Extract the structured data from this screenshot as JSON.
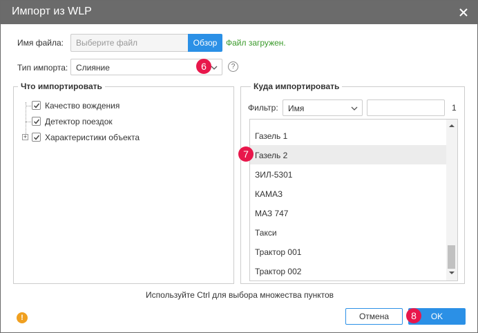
{
  "dialog": {
    "title": "Импорт из WLP"
  },
  "file": {
    "label": "Имя файла:",
    "placeholder": "Выберите файл",
    "browse_label": "Обзор",
    "status": "Файл загружен."
  },
  "import_type": {
    "label": "Тип импорта:",
    "value": "Слияние"
  },
  "what_to_import": {
    "title": "Что импортировать",
    "items": [
      {
        "label": "Качество вождения",
        "checked": true
      },
      {
        "label": "Детектор поездок",
        "checked": true
      },
      {
        "label": "Характеристики объекта",
        "checked": true,
        "expandable": true
      }
    ]
  },
  "where_to_import": {
    "title": "Куда импортировать",
    "filter_label": "Фильтр:",
    "filter_value": "Имя",
    "filter_text": "",
    "count": "1",
    "items": [
      {
        "label": "Газель 1"
      },
      {
        "label": "Газель 2",
        "selected": true
      },
      {
        "label": "ЗИЛ-5301"
      },
      {
        "label": "КАМАЗ"
      },
      {
        "label": "МАЗ 747"
      },
      {
        "label": "Такси"
      },
      {
        "label": "Трактор 001"
      },
      {
        "label": "Трактор 002"
      }
    ]
  },
  "hint": "Используйте Ctrl для выбора множества пунктов",
  "buttons": {
    "cancel": "Отмена",
    "ok": "OK"
  },
  "badges": {
    "import_type": "6",
    "list": "7",
    "ok": "8"
  },
  "colors": {
    "titlebar": "#6b6b6b",
    "accent": "#2b90e6",
    "success": "#3a9a2a",
    "badge": "#e8174b",
    "warning": "#f0a020"
  }
}
